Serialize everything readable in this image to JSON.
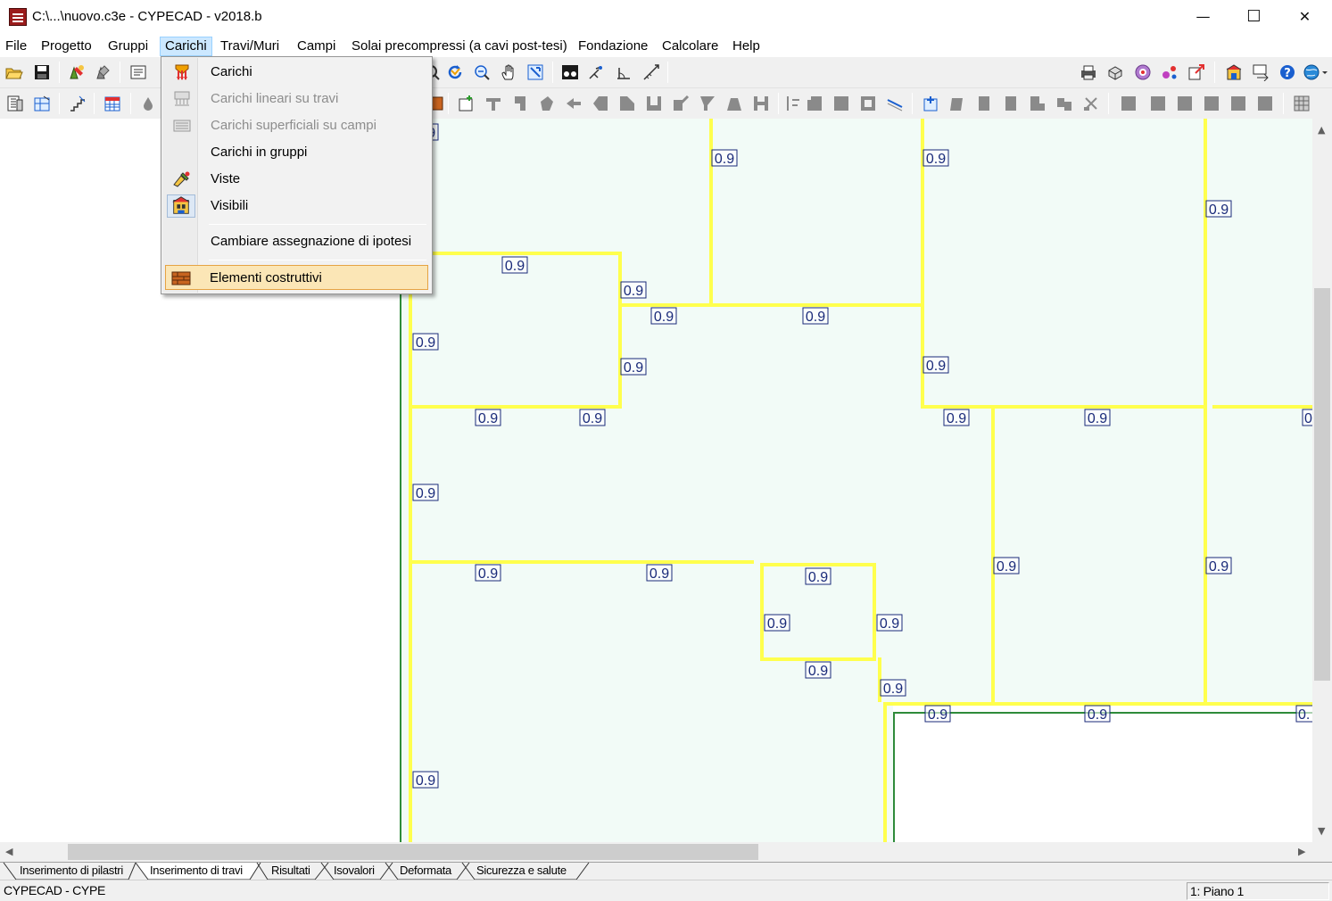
{
  "window": {
    "title": "C:\\...\\nuovo.c3e - CYPECAD - v2018.b",
    "minimize": "—",
    "maximize": "☐",
    "close": "✕"
  },
  "menubar": {
    "items": [
      "File",
      "Progetto",
      "Gruppi",
      "Carichi",
      "Travi/Muri",
      "Campi",
      "Solai precompressi (a cavi post-tesi)",
      "Fondazione",
      "Calcolare",
      "Help"
    ],
    "active": "Carichi"
  },
  "dropdown": {
    "items": [
      {
        "label": "Carichi",
        "icon": "load-arrows-icon",
        "enabled": true
      },
      {
        "label": "Carichi lineari su travi",
        "icon": "linear-loads-icon",
        "enabled": false
      },
      {
        "label": "Carichi superficiali su campi",
        "icon": "surface-loads-icon",
        "enabled": false
      },
      {
        "label": "Carichi in gruppi",
        "icon": "",
        "enabled": true
      },
      {
        "label": "Viste",
        "icon": "views-icon",
        "enabled": true
      },
      {
        "label": "Visibili",
        "icon": "visibility-icon",
        "enabled": true,
        "checked": true
      },
      {
        "label": "Cambiare assegnazione di ipotesi",
        "icon": "",
        "enabled": true
      },
      {
        "label": "Elementi costruttivi",
        "icon": "construction-elements-icon",
        "enabled": true,
        "highlighted": true
      }
    ]
  },
  "canvas": {
    "background": "#f2fbf7",
    "beam_color": "#ffff4d",
    "border_color": "#2e8b3a",
    "label_color": "#1a2a7a",
    "beam_label": "0.9",
    "beam_label_partial": "0."
  },
  "tabs": [
    "Inserimento di pilastri",
    "Inserimento di travi",
    "Risultati",
    "Isovalori",
    "Deformata",
    "Sicurezza e salute"
  ],
  "active_tab": "Inserimento di travi",
  "statusbar": {
    "left": "CYPECAD - CYPE",
    "right": "1: Piano 1"
  }
}
